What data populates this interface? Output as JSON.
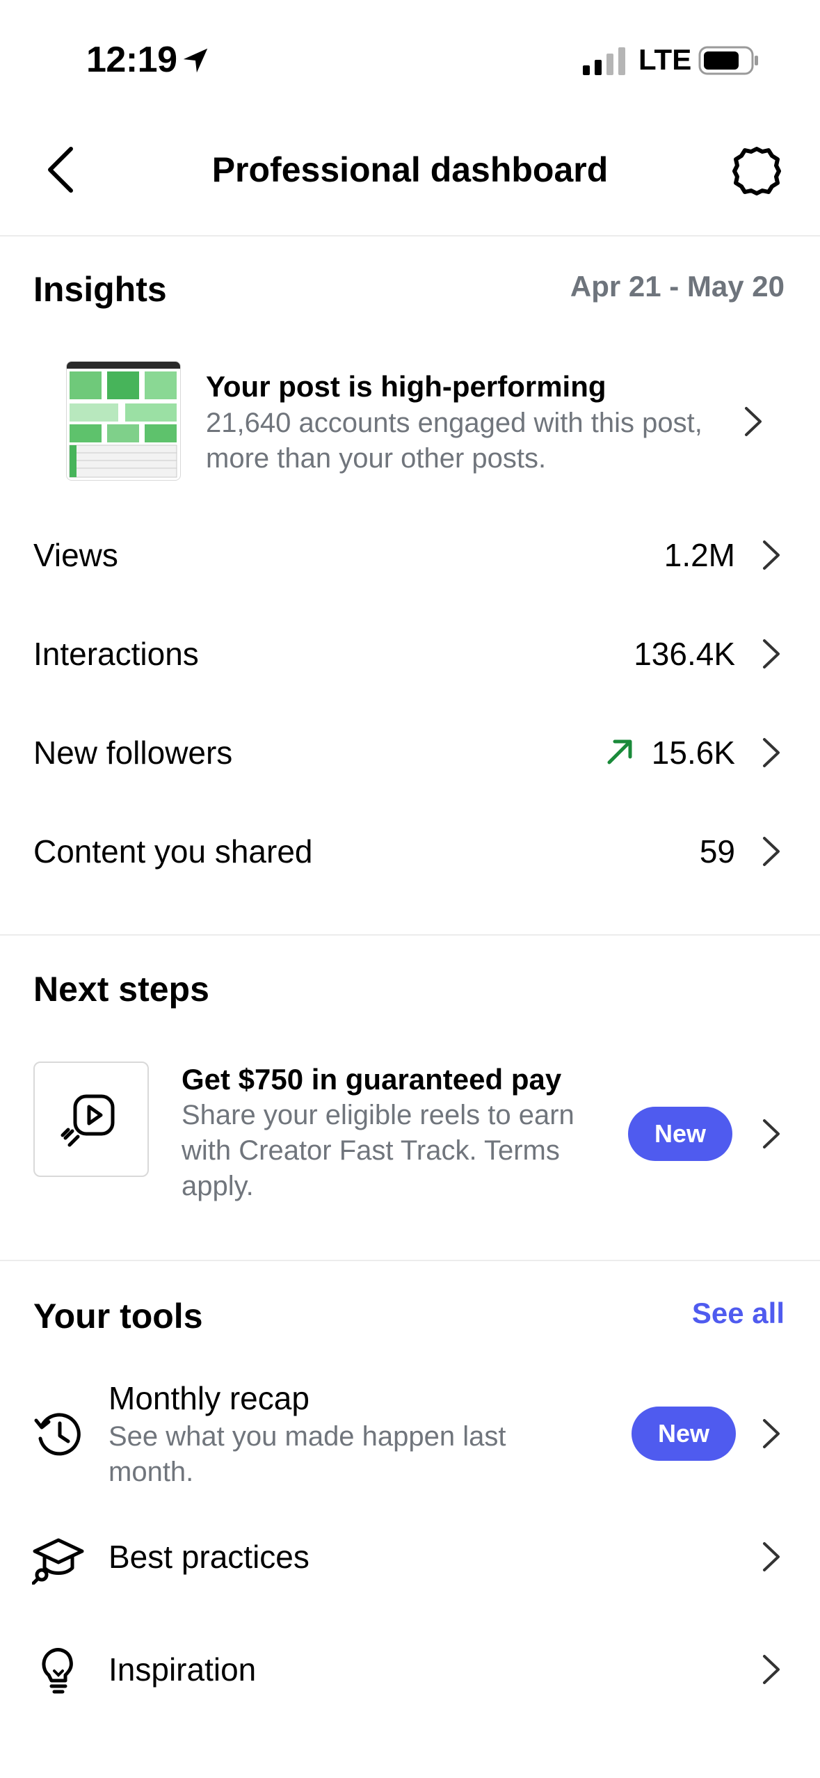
{
  "status_bar": {
    "time": "12:19",
    "network": "LTE",
    "icons": [
      "location-arrow-icon",
      "signal-icon",
      "battery-icon"
    ]
  },
  "header": {
    "title": "Professional dashboard",
    "icons": [
      "back-chevron-icon",
      "settings-gear-icon"
    ]
  },
  "insights": {
    "title": "Insights",
    "date_range": "Apr 21 - May 20",
    "highlight": {
      "title": "Your post is high-performing",
      "description": "21,640 accounts engaged with this post, more than your other posts."
    },
    "metrics": [
      {
        "label": "Views",
        "value": "1.2M"
      },
      {
        "label": "Interactions",
        "value": "136.4K"
      },
      {
        "label": "New followers",
        "value": "15.6K",
        "trend": "up"
      },
      {
        "label": "Content you shared",
        "value": "59"
      }
    ]
  },
  "next_steps": {
    "title": "Next steps",
    "card": {
      "title": "Get $750 in guaranteed pay",
      "description": "Share your eligible reels to earn with Creator Fast Track. Terms apply.",
      "badge": "New",
      "icon": "reels-play-icon"
    }
  },
  "tools": {
    "title": "Your tools",
    "see_all": "See all",
    "items": [
      {
        "title": "Monthly recap",
        "description": "See what you made happen last month.",
        "badge": "New",
        "icon": "history-clock-icon"
      },
      {
        "title": "Best practices",
        "icon": "graduation-cap-icon"
      },
      {
        "title": "Inspiration",
        "icon": "lightbulb-icon"
      }
    ]
  },
  "colors": {
    "accent": "#4f5bef",
    "secondary_text": "#70757c",
    "trend_up": "#1a8a3a"
  }
}
